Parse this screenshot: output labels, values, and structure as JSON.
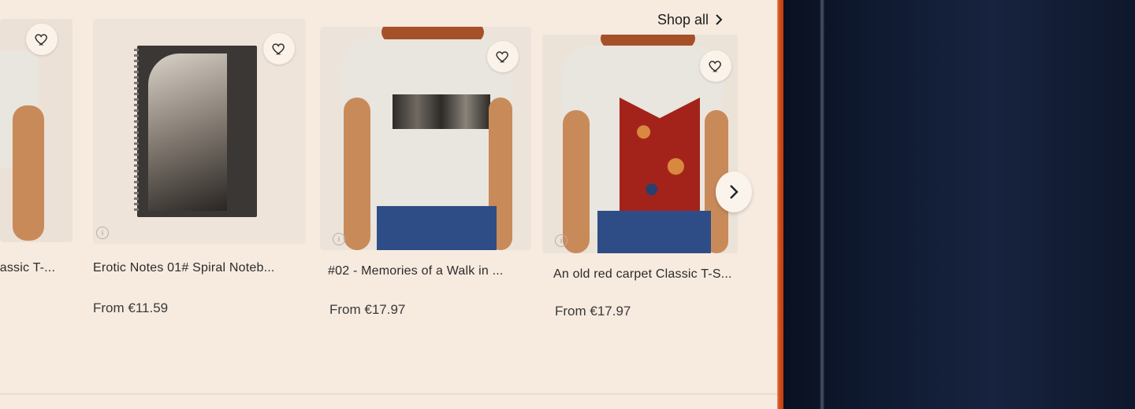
{
  "header": {
    "shop_all_label": "Shop all"
  },
  "products": [
    {
      "title": "lassic T-...",
      "price": "",
      "image": "t-shirt-photo"
    },
    {
      "title": "Erotic Notes 01# Spiral Noteb...",
      "price": "From €11.59",
      "image": "spiral-notebook-photo"
    },
    {
      "title": "#02 - Memories of a Walk in ...",
      "price": "From €17.97",
      "image": "t-shirt-photo-print"
    },
    {
      "title": "An old red carpet Classic T-S...",
      "price": "From €17.97",
      "image": "t-shirt-photo-red-carpet"
    }
  ],
  "icons": {
    "favorite": "heart-outline-icon",
    "next": "chevron-right-icon",
    "info": "info-icon"
  },
  "colors": {
    "screen_bg": "#f7ebe0",
    "device_accent": "#d9531f",
    "text": "#2b2b2b"
  }
}
